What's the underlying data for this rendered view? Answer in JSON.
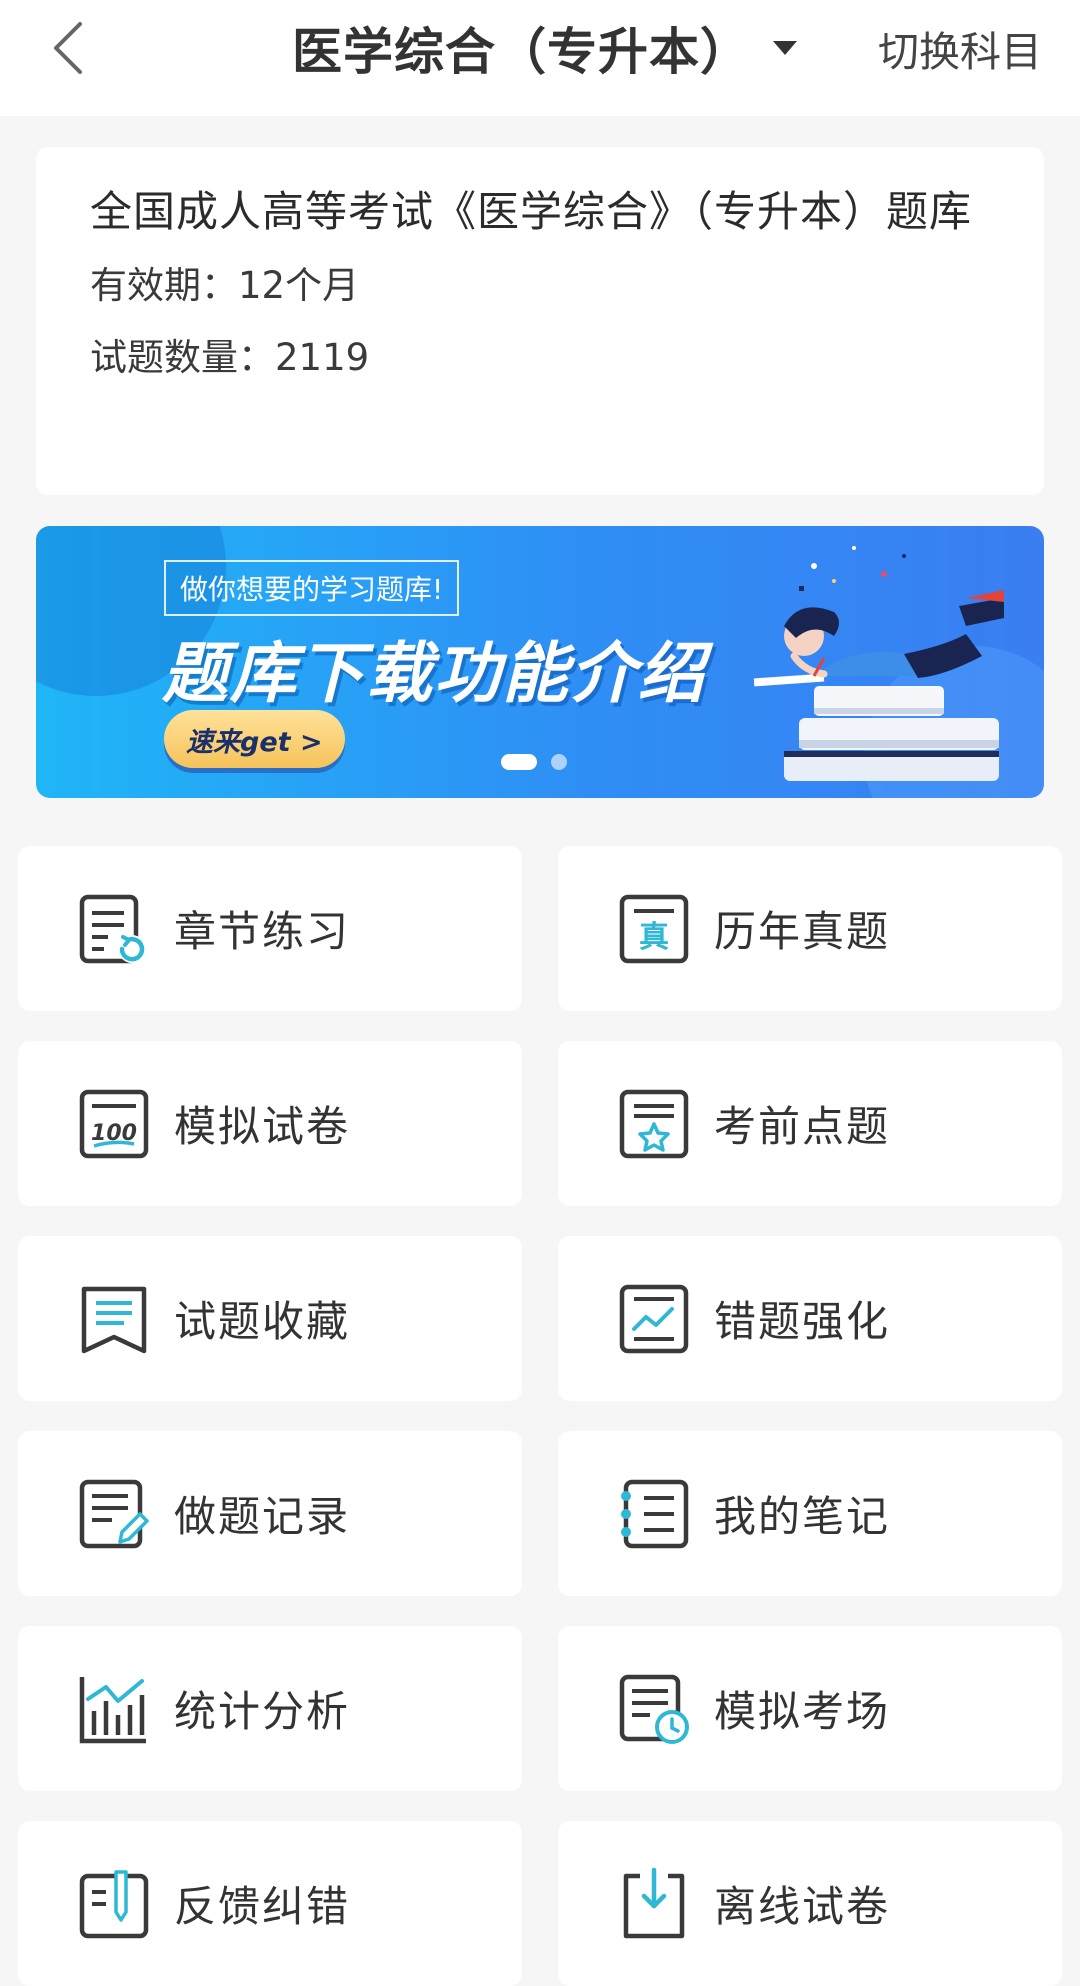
{
  "header": {
    "title": "医学综合（专升本）",
    "switch_label": "切换科目"
  },
  "info": {
    "title": "全国成人高等考试《医学综合》（专升本）题库",
    "validity": "有效期：12个月",
    "count": "试题数量：2119"
  },
  "banner": {
    "tag": "做你想要的学习题库!",
    "title": "题库下载功能介绍",
    "cta": "速来get >",
    "slide_count": 2,
    "active_slide": 1
  },
  "menu": [
    {
      "label": "章节练习",
      "icon": "chapter-practice-icon"
    },
    {
      "label": "历年真题",
      "icon": "past-exams-icon"
    },
    {
      "label": "模拟试卷",
      "icon": "mock-paper-icon"
    },
    {
      "label": "考前点题",
      "icon": "pre-exam-tips-icon"
    },
    {
      "label": "试题收藏",
      "icon": "favorites-icon"
    },
    {
      "label": "错题强化",
      "icon": "mistakes-icon"
    },
    {
      "label": "做题记录",
      "icon": "practice-record-icon"
    },
    {
      "label": "我的笔记",
      "icon": "notes-icon"
    },
    {
      "label": "统计分析",
      "icon": "statistics-icon"
    },
    {
      "label": "模拟考场",
      "icon": "mock-exam-room-icon"
    },
    {
      "label": "反馈纠错",
      "icon": "feedback-icon"
    },
    {
      "label": "离线试卷",
      "icon": "offline-paper-icon"
    }
  ],
  "colors": {
    "accent": "#2fb8d6",
    "icon_dark": "#3a3a3a",
    "banner_start": "#1fb6f7",
    "banner_end": "#3a7ef2"
  }
}
